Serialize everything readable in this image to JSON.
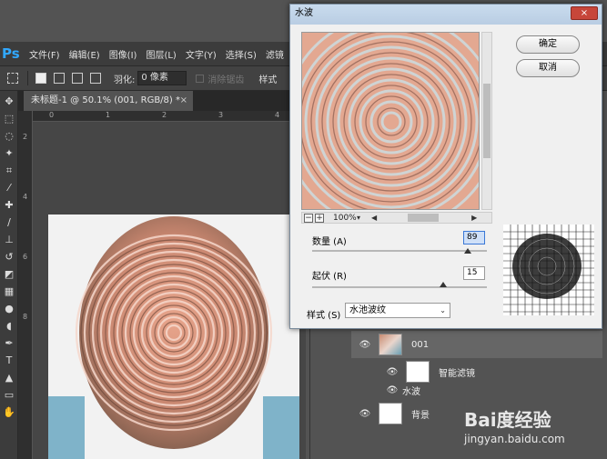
{
  "menubar": {
    "app_logo": "Ps",
    "items": [
      "文件(F)",
      "编辑(E)",
      "图像(I)",
      "图层(L)",
      "文字(Y)",
      "选择(S)",
      "滤镜"
    ]
  },
  "options_bar": {
    "feather_label": "羽化:",
    "feather_value": "0 像素",
    "antialias_label": "消除锯齿",
    "style_label": "样式"
  },
  "document_tab": {
    "title": "未标题-1 @ 50.1% (001, RGB/8) *",
    "close": "×"
  },
  "ruler": {
    "h_ticks": [
      "0",
      "1",
      "2",
      "3",
      "4"
    ],
    "v_ticks": [
      "2",
      "4",
      "6",
      "8"
    ]
  },
  "dialog": {
    "title": "水波",
    "close": "×",
    "ok_label": "确定",
    "cancel_label": "取消",
    "zoom_value": "100%",
    "params": [
      {
        "label": "数量 (A)",
        "value": "89",
        "slider_fraction": 0.89
      },
      {
        "label": "起伏 (R)",
        "value": "15",
        "slider_fraction": 0.75
      }
    ],
    "style_label": "样式 (S)",
    "style_value": "水池波纹"
  },
  "layers": [
    {
      "name": "001",
      "thumb": "photo",
      "selected": true
    },
    {
      "name": "智能滤镜",
      "thumb": "white",
      "selected": false
    },
    {
      "name": "水波",
      "thumb": "none",
      "selected": false
    },
    {
      "name": "背景",
      "thumb": "white",
      "selected": false
    }
  ],
  "watermark": {
    "brand": "Bai度经验",
    "url": "jingyan.baidu.com"
  },
  "colors": {
    "accent": "#31a8ff",
    "close_red": "#c7463a"
  }
}
